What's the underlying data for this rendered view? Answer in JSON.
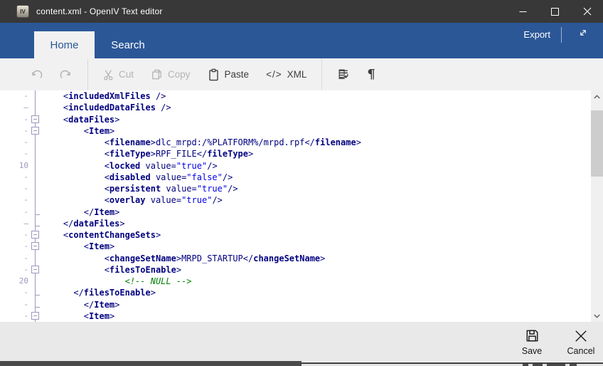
{
  "window": {
    "title": "content.xml - OpenIV Text editor",
    "app_icon_text": "IV",
    "controls": [
      {
        "name": "minimize-button",
        "icon": "minimize-icon"
      },
      {
        "name": "maximize-button",
        "icon": "maximize-icon"
      },
      {
        "name": "close-button",
        "icon": "close-icon"
      }
    ]
  },
  "ribbon": {
    "tabs": [
      {
        "label": "Home",
        "active": true
      },
      {
        "label": "Search",
        "active": false
      }
    ],
    "export_label": "Export",
    "expand_icon": "expand-icon"
  },
  "toolbar": {
    "items": [
      {
        "type": "button",
        "id": "undo",
        "icon": "undo-icon",
        "label": "",
        "enabled": false
      },
      {
        "type": "button",
        "id": "redo",
        "icon": "redo-icon",
        "label": "",
        "enabled": false
      },
      {
        "type": "separator"
      },
      {
        "type": "button",
        "id": "cut",
        "icon": "scissors-icon",
        "label": "Cut",
        "enabled": false
      },
      {
        "type": "button",
        "id": "copy",
        "icon": "copy-icon",
        "label": "Copy",
        "enabled": false
      },
      {
        "type": "button",
        "id": "paste",
        "icon": "clipboard-icon",
        "label": "Paste",
        "enabled": true
      },
      {
        "type": "button",
        "id": "xml",
        "icon": "code-icon",
        "label": "XML",
        "enabled": true
      },
      {
        "type": "separator"
      },
      {
        "type": "button",
        "id": "word-wrap",
        "icon": "word-wrap-icon",
        "label": "",
        "enabled": true
      },
      {
        "type": "button",
        "id": "formatting-marks",
        "icon": "pilcrow-icon",
        "label": "",
        "enabled": true
      }
    ]
  },
  "editor": {
    "lines": [
      {
        "num": "-",
        "fold": "line",
        "code": [
          [
            "n",
            "    <"
          ],
          [
            "b",
            "includedXmlFiles"
          ],
          [
            "n",
            " />"
          ]
        ]
      },
      {
        "num": "–",
        "fold": "line",
        "code": [
          [
            "n",
            "    <"
          ],
          [
            "b",
            "includedDataFiles"
          ],
          [
            "n",
            " />"
          ]
        ]
      },
      {
        "num": "-",
        "fold": "box",
        "code": [
          [
            "n",
            "    <"
          ],
          [
            "b",
            "dataFiles"
          ],
          [
            "n",
            ">"
          ]
        ]
      },
      {
        "num": "-",
        "fold": "box",
        "code": [
          [
            "n",
            "        <"
          ],
          [
            "b",
            "Item"
          ],
          [
            "n",
            ">"
          ]
        ]
      },
      {
        "num": "-",
        "fold": "line",
        "code": [
          [
            "n",
            "            <"
          ],
          [
            "b",
            "filename"
          ],
          [
            "n",
            ">dlc_mrpd:/%PLATFORM%/mrpd.rpf</"
          ],
          [
            "b",
            "filename"
          ],
          [
            "n",
            ">"
          ]
        ]
      },
      {
        "num": "-",
        "fold": "line",
        "code": [
          [
            "n",
            "            <"
          ],
          [
            "b",
            "fileType"
          ],
          [
            "n",
            ">RPF_FILE</"
          ],
          [
            "b",
            "fileType"
          ],
          [
            "n",
            ">"
          ]
        ]
      },
      {
        "num": "10",
        "fold": "line",
        "code": [
          [
            "n",
            "            <"
          ],
          [
            "b",
            "locked"
          ],
          [
            "n",
            " value="
          ],
          [
            "v",
            "\"true\""
          ],
          [
            "n",
            "/>"
          ]
        ]
      },
      {
        "num": "-",
        "fold": "line",
        "code": [
          [
            "n",
            "            <"
          ],
          [
            "b",
            "disabled"
          ],
          [
            "n",
            " value="
          ],
          [
            "v",
            "\"false\""
          ],
          [
            "n",
            "/>"
          ]
        ]
      },
      {
        "num": "-",
        "fold": "line",
        "code": [
          [
            "n",
            "            <"
          ],
          [
            "b",
            "persistent"
          ],
          [
            "n",
            " value="
          ],
          [
            "v",
            "\"true\""
          ],
          [
            "n",
            "/>"
          ]
        ]
      },
      {
        "num": "-",
        "fold": "line",
        "code": [
          [
            "n",
            "            <"
          ],
          [
            "b",
            "overlay"
          ],
          [
            "n",
            " value="
          ],
          [
            "v",
            "\"true\""
          ],
          [
            "n",
            "/>"
          ]
        ]
      },
      {
        "num": "-",
        "fold": "end",
        "code": [
          [
            "n",
            "        </"
          ],
          [
            "b",
            "Item"
          ],
          [
            "n",
            ">"
          ]
        ]
      },
      {
        "num": "–",
        "fold": "end",
        "code": [
          [
            "n",
            "    </"
          ],
          [
            "b",
            "dataFiles"
          ],
          [
            "n",
            ">"
          ]
        ]
      },
      {
        "num": "-",
        "fold": "box",
        "code": [
          [
            "n",
            "    <"
          ],
          [
            "b",
            "contentChangeSets"
          ],
          [
            "n",
            ">"
          ]
        ]
      },
      {
        "num": "-",
        "fold": "box",
        "code": [
          [
            "n",
            "        <"
          ],
          [
            "b",
            "Item"
          ],
          [
            "n",
            ">"
          ]
        ]
      },
      {
        "num": "-",
        "fold": "line",
        "code": [
          [
            "n",
            "            <"
          ],
          [
            "b",
            "changeSetName"
          ],
          [
            "n",
            ">MRPD_STARTUP</"
          ],
          [
            "b",
            "changeSetName"
          ],
          [
            "n",
            ">"
          ]
        ]
      },
      {
        "num": "-",
        "fold": "box",
        "code": [
          [
            "n",
            "            <"
          ],
          [
            "b",
            "filesToEnable"
          ],
          [
            "n",
            ">"
          ]
        ]
      },
      {
        "num": "20",
        "fold": "line",
        "code": [
          [
            "c",
            "                <!-- NULL -->"
          ]
        ]
      },
      {
        "num": "-",
        "fold": "end",
        "code": [
          [
            "n",
            "      </"
          ],
          [
            "b",
            "filesToEnable"
          ],
          [
            "n",
            ">"
          ]
        ]
      },
      {
        "num": "-",
        "fold": "end",
        "code": [
          [
            "n",
            "        </"
          ],
          [
            "b",
            "Item"
          ],
          [
            "n",
            ">"
          ]
        ]
      },
      {
        "num": "-",
        "fold": "box",
        "code": [
          [
            "n",
            "        <"
          ],
          [
            "b",
            "Item"
          ],
          [
            "n",
            ">"
          ]
        ]
      }
    ]
  },
  "footer": {
    "buttons": [
      {
        "id": "save",
        "icon": "save-icon",
        "label": "Save"
      },
      {
        "id": "cancel",
        "icon": "cancel-icon",
        "label": "Cancel"
      }
    ]
  },
  "colors": {
    "ribbon_blue": "#2B5797",
    "titlebar_gray": "#383838",
    "tag_navy": "#000080",
    "attr_value_blue": "#0000E6",
    "comment_green": "#008000",
    "gutter_purple": "#9B99BF"
  }
}
